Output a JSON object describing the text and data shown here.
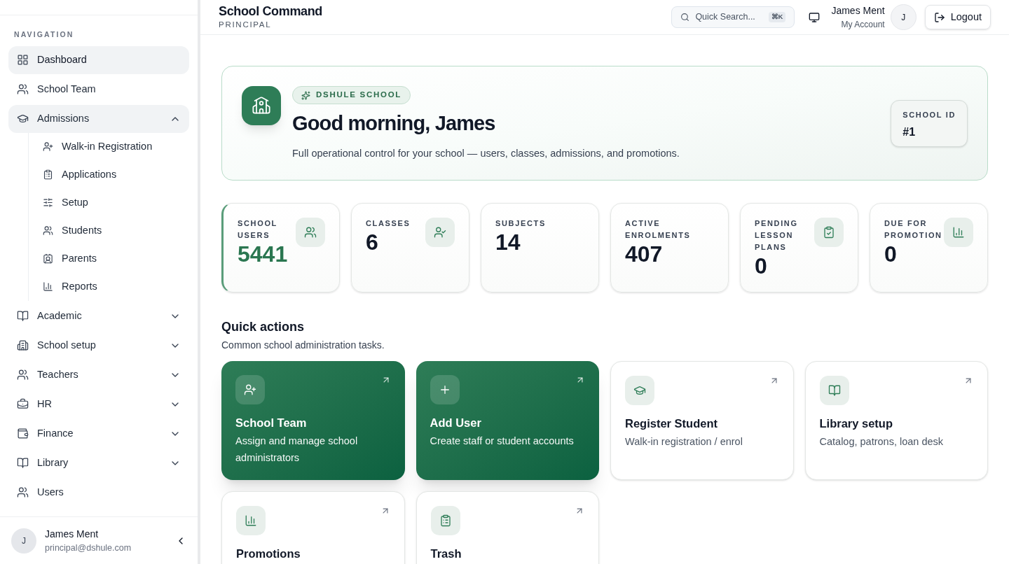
{
  "sidebar": {
    "heading": "NAVIGATION",
    "items": [
      {
        "label": "Dashboard",
        "selected": true
      },
      {
        "label": "School Team",
        "selected": false
      },
      {
        "label": "Admissions",
        "selected": false,
        "expanded": true,
        "children": [
          {
            "label": "Walk-in Registration",
            "selected": false
          },
          {
            "label": "Applications",
            "selected": false
          },
          {
            "label": "Setup",
            "selected": false
          },
          {
            "label": "Students",
            "selected": false
          },
          {
            "label": "Parents",
            "selected": false
          },
          {
            "label": "Reports",
            "selected": false
          }
        ]
      },
      {
        "label": "Academic",
        "selected": false,
        "expanded": false
      },
      {
        "label": "School setup",
        "selected": false,
        "expanded": false
      },
      {
        "label": "Teachers",
        "selected": false,
        "expanded": false
      },
      {
        "label": "HR",
        "selected": false,
        "expanded": false
      },
      {
        "label": "Finance",
        "selected": false,
        "expanded": false
      },
      {
        "label": "Library",
        "selected": false,
        "expanded": false
      },
      {
        "label": "Users",
        "selected": false
      }
    ],
    "user": {
      "initial": "J",
      "name": "James Ment",
      "email": "principal@dshule.com"
    }
  },
  "header": {
    "title": "School Command",
    "role": "PRINCIPAL",
    "search": {
      "placeholder": "Quick Search...",
      "shortcut": "⌘K"
    },
    "user": {
      "name": "James Ment",
      "subtitle": "My Account",
      "initial": "J"
    },
    "logout": "Logout"
  },
  "hero": {
    "badge": "DSHULE SCHOOL",
    "greeting": "Good morning, James",
    "description": "Full operational control for your school — users, classes, admissions, and promotions.",
    "id_label": "SCHOOL ID",
    "id_value": "#1"
  },
  "stats": [
    {
      "label": "SCHOOL USERS",
      "value": "5441",
      "selected": true
    },
    {
      "label": "CLASSES",
      "value": "6",
      "selected": false
    },
    {
      "label": "SUBJECTS",
      "value": "14",
      "selected": false
    },
    {
      "label": "ACTIVE ENROLMENTS",
      "value": "407",
      "selected": false
    },
    {
      "label": "PENDING LESSON PLANS",
      "value": "0",
      "selected": false
    },
    {
      "label": "DUE FOR PROMOTION",
      "value": "0",
      "selected": false
    }
  ],
  "quick_actions": {
    "title": "Quick actions",
    "subtitle": "Common school administration tasks.",
    "items": [
      {
        "kind": "primary",
        "title": "School Team",
        "description": "Assign and manage school administrators"
      },
      {
        "kind": "primary",
        "title": "Add User",
        "description": "Create staff or student accounts"
      },
      {
        "kind": "plain",
        "title": "Register Student",
        "description": "Walk-in registration / enrol"
      },
      {
        "kind": "plain",
        "title": "Library setup",
        "description": "Catalog, patrons, loan desk"
      },
      {
        "kind": "plain",
        "title": "Promotions"
      },
      {
        "kind": "plain",
        "title": "Trash"
      }
    ]
  }
}
